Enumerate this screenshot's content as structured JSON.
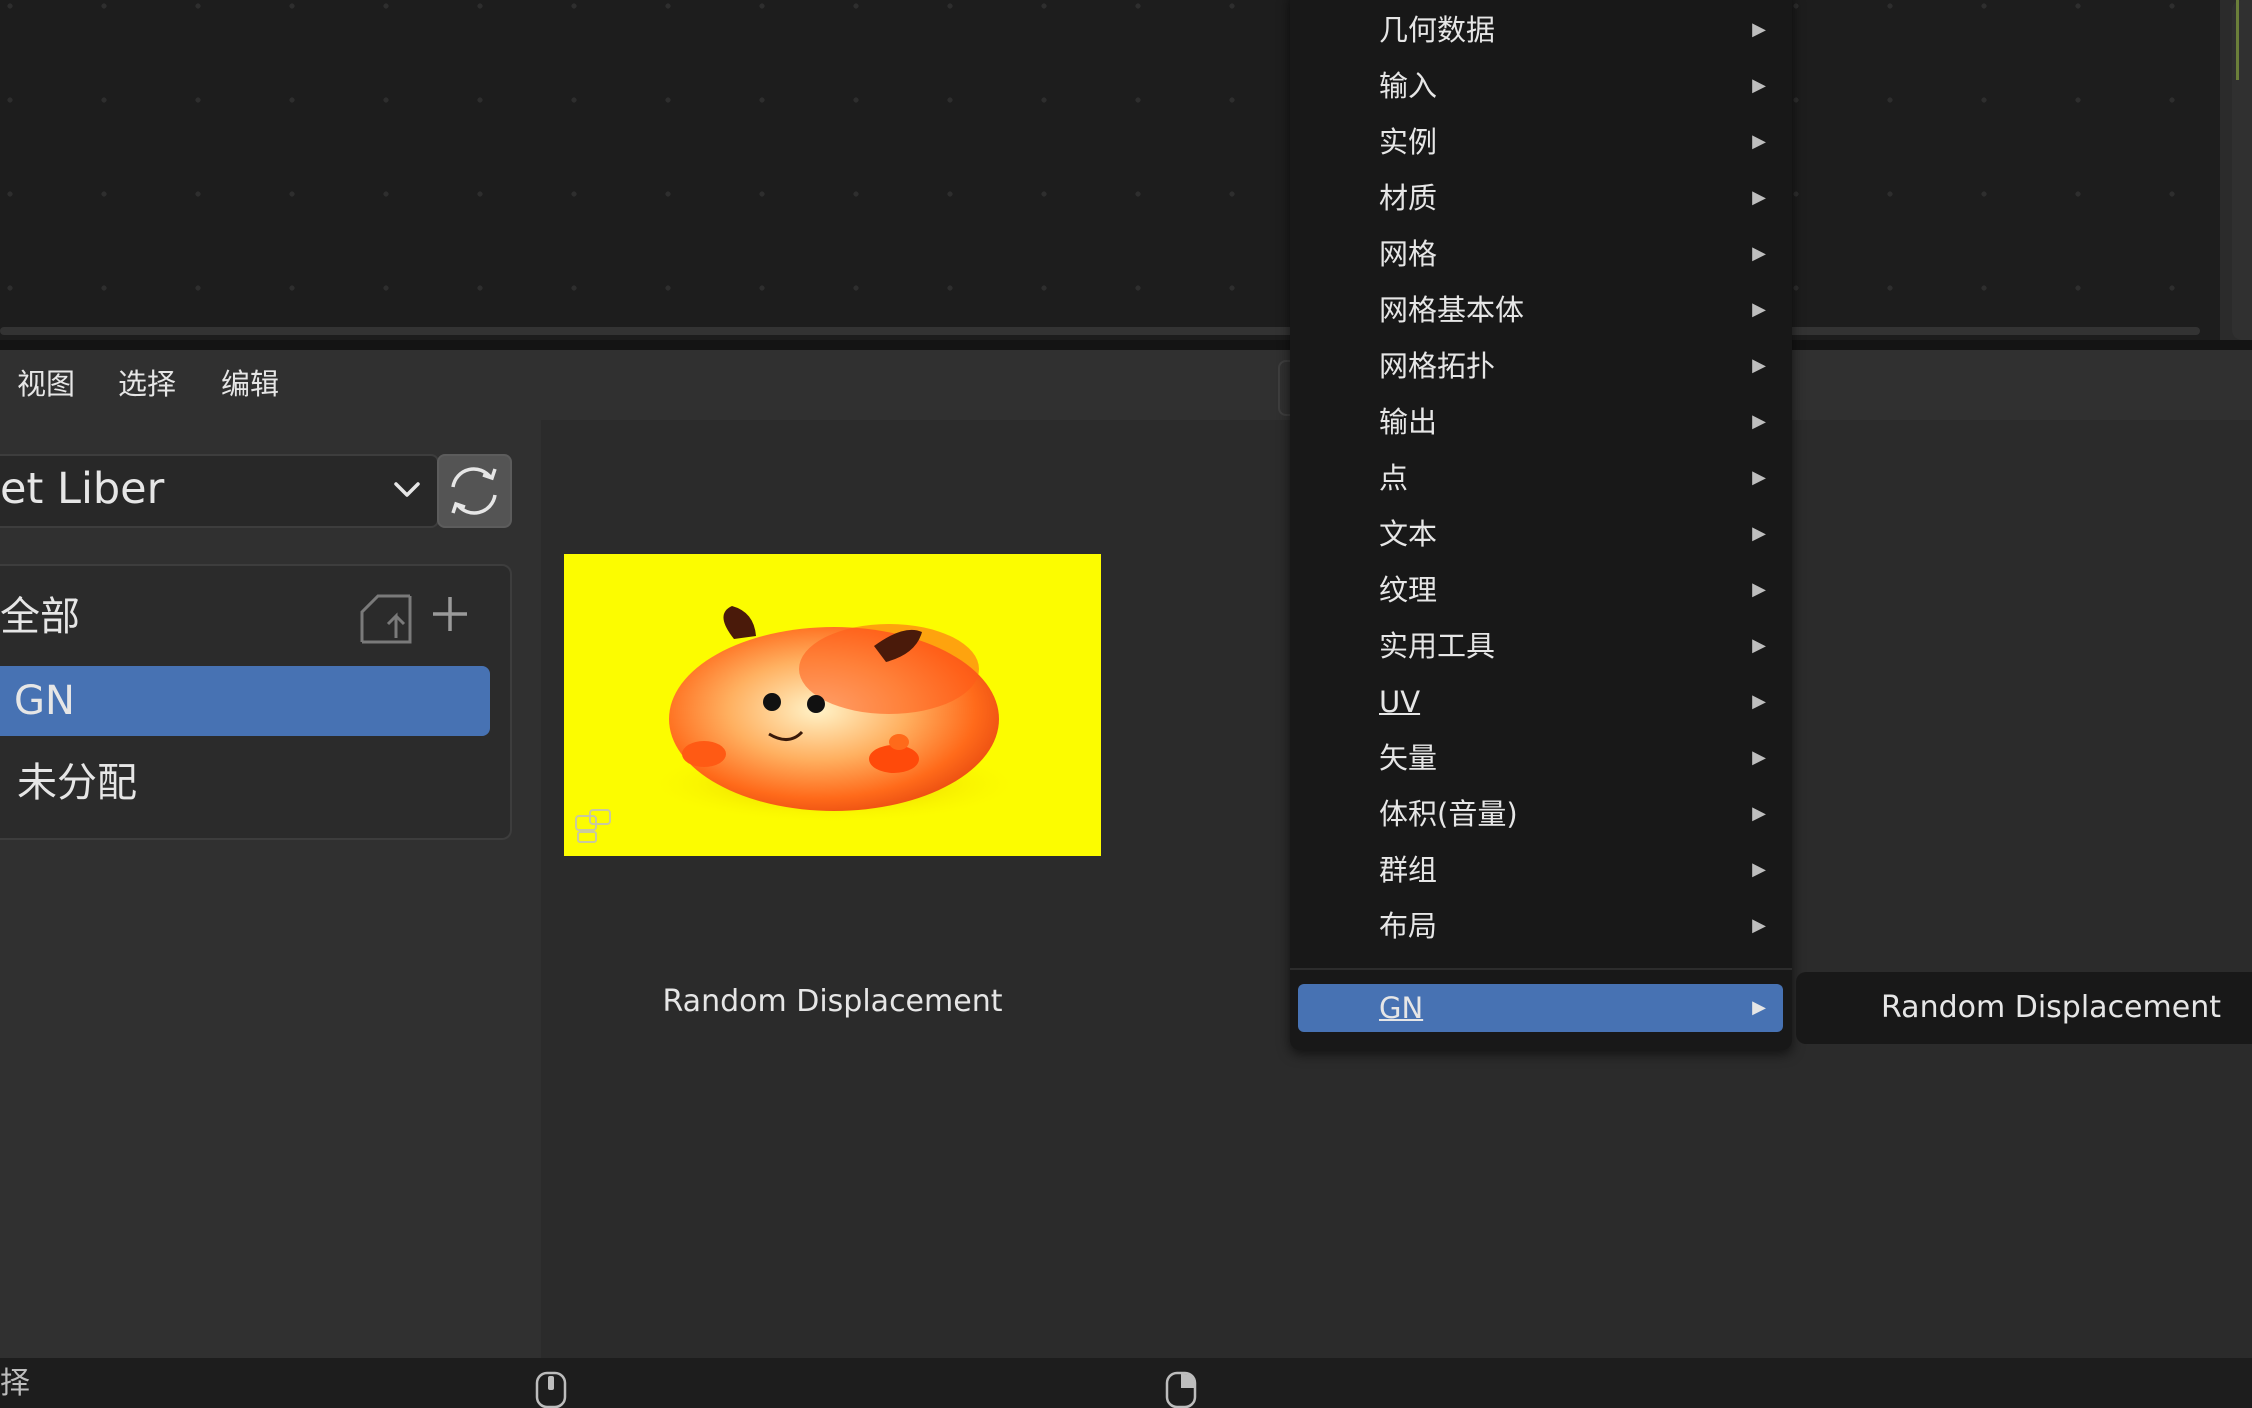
{
  "header": {
    "menu": [
      "视图",
      "选择",
      "编辑"
    ]
  },
  "library": {
    "name": "et Liber"
  },
  "catalogs": {
    "items": [
      "全部",
      "GN",
      "未分配"
    ],
    "selected": "GN"
  },
  "asset": {
    "name": "Random Displacement"
  },
  "status_bar": {
    "left_text": "择"
  },
  "add_menu": {
    "items": [
      "几何数据",
      "输入",
      "实例",
      "材质",
      "网格",
      "网格基本体",
      "网格拓扑",
      "输出",
      "点",
      "文本",
      "纹理",
      "实用工具",
      "UV",
      "矢量",
      "体积(音量)",
      "群组",
      "布局"
    ],
    "active_item": "GN",
    "submenu_items": [
      "Random Displacement"
    ]
  },
  "colors": {
    "accent": "#4772b3",
    "thumbnail_bg": "#fcfc00"
  }
}
